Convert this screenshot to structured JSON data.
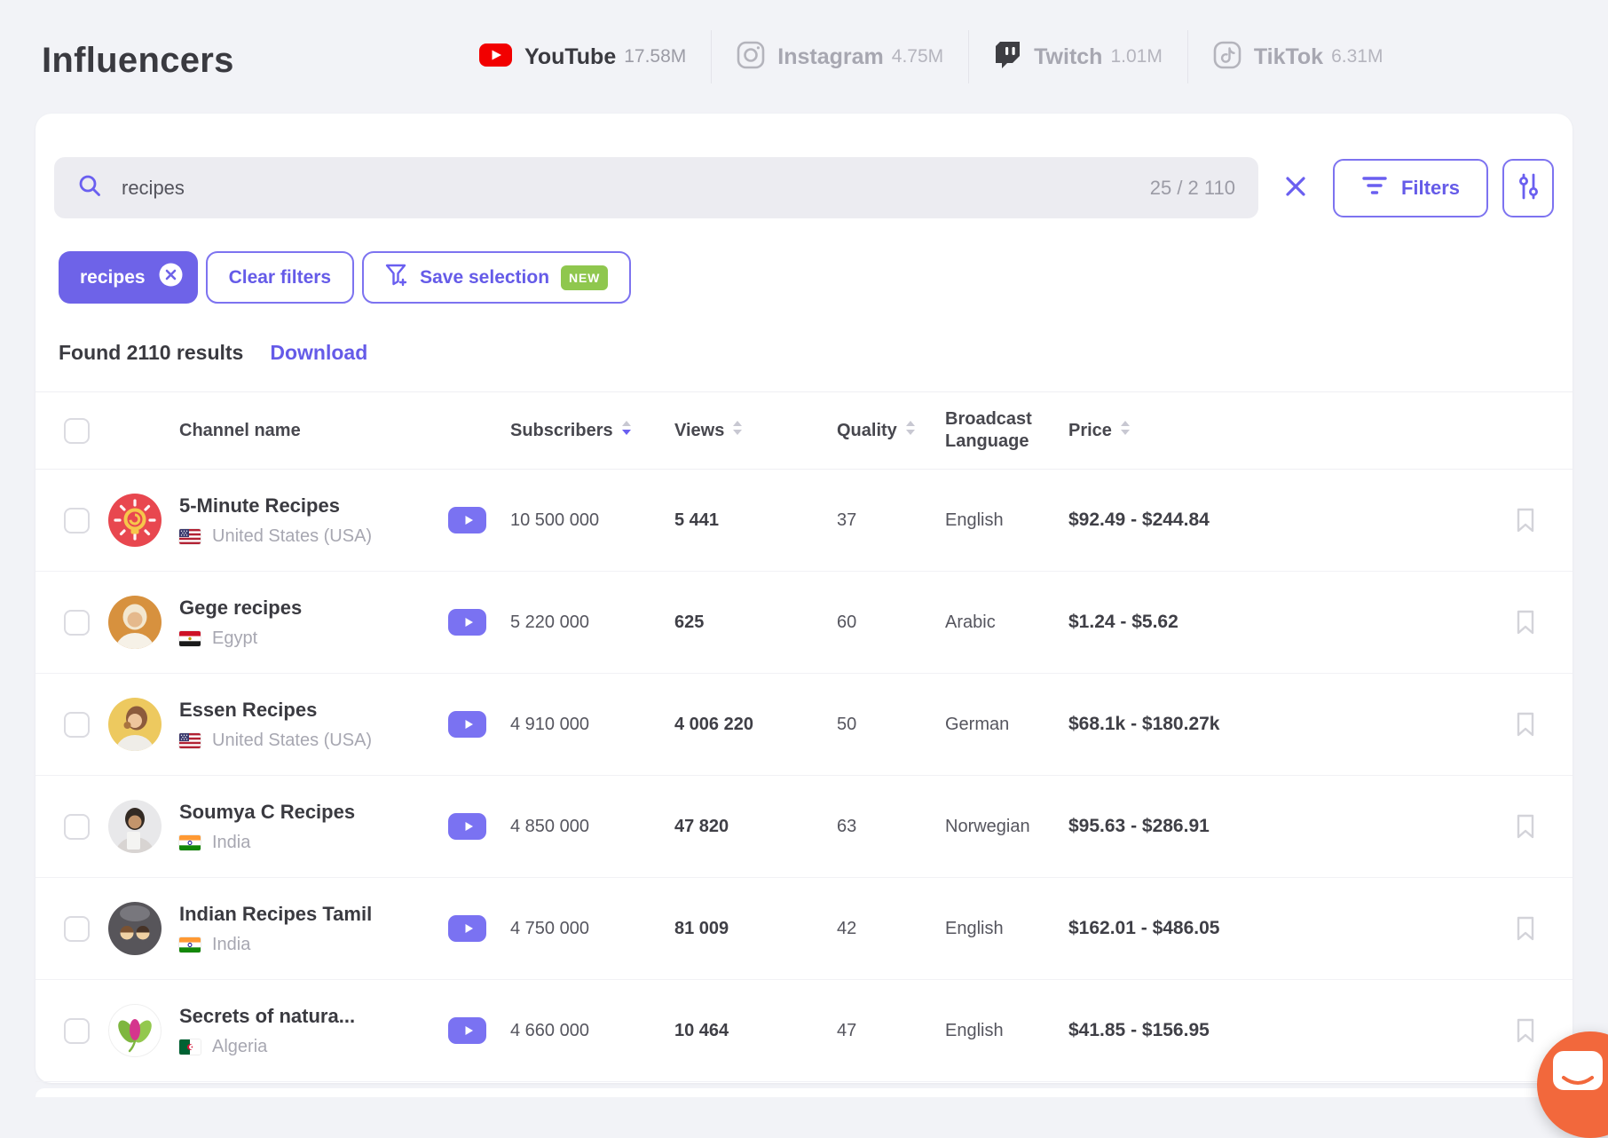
{
  "page": {
    "title": "Influencers"
  },
  "platform_tabs": [
    {
      "label": "YouTube",
      "count": "17.58M",
      "icon": "youtube-icon",
      "active": true
    },
    {
      "label": "Instagram",
      "count": "4.75M",
      "icon": "instagram-icon",
      "active": false
    },
    {
      "label": "Twitch",
      "count": "1.01M",
      "icon": "twitch-icon",
      "active": false
    },
    {
      "label": "TikTok",
      "count": "6.31M",
      "icon": "tiktok-icon",
      "active": false
    }
  ],
  "search": {
    "query": "recipes",
    "counter": "25 / 2 110"
  },
  "toolbar": {
    "filters_label": "Filters",
    "chip_label": "recipes",
    "clear_filters_label": "Clear filters",
    "save_selection_label": "Save selection",
    "new_badge": "NEW"
  },
  "results": {
    "found_text": "Found 2110 results",
    "download_label": "Download"
  },
  "table": {
    "columns": [
      {
        "label": "Channel name",
        "sortable": false
      },
      {
        "label": "Subscribers",
        "sortable": true,
        "sort_active": "desc"
      },
      {
        "label": "Views",
        "sortable": true
      },
      {
        "label": "Quality",
        "sortable": true
      },
      {
        "label": "Broadcast Language",
        "sortable": false
      },
      {
        "label": "Price",
        "sortable": true
      }
    ],
    "rows": [
      {
        "name": "5-Minute Recipes",
        "country": "United States (USA)",
        "flag": "usa-flag",
        "avatar": "red-lightbulb-logo",
        "subscribers": "10 500 000",
        "views": "5 441",
        "quality": "37",
        "language": "English",
        "price": "$92.49 - $244.84"
      },
      {
        "name": "Gege recipes",
        "country": "Egypt",
        "flag": "egypt-flag",
        "avatar": "woman-hijab-portrait",
        "subscribers": "5 220 000",
        "views": "625",
        "quality": "60",
        "language": "Arabic",
        "price": "$1.24 - $5.62"
      },
      {
        "name": "Essen Recipes",
        "country": "United States (USA)",
        "flag": "usa-flag",
        "avatar": "woman-eating-portrait",
        "subscribers": "4 910 000",
        "views": "4 006 220",
        "quality": "50",
        "language": "German",
        "price": "$68.1k - $180.27k"
      },
      {
        "name": "Soumya C Recipes",
        "country": "India",
        "flag": "india-flag",
        "avatar": "woman-portrait",
        "subscribers": "4 850 000",
        "views": "47 820",
        "quality": "63",
        "language": "Norwegian",
        "price": "$95.63 - $286.91"
      },
      {
        "name": "Indian Recipes Tamil",
        "country": "India",
        "flag": "india-flag",
        "avatar": "cartoon-couple-logo",
        "subscribers": "4 750 000",
        "views": "81 009",
        "quality": "42",
        "language": "English",
        "price": "$162.01 - $486.05"
      },
      {
        "name": "Secrets of natura...",
        "country": "Algeria",
        "flag": "algeria-flag",
        "avatar": "pink-green-leaves-logo",
        "subscribers": "4 660 000",
        "views": "10 464",
        "quality": "47",
        "language": "English",
        "price": "$41.85 - $156.95"
      }
    ]
  },
  "colors": {
    "accent_purple": "#655BE8",
    "chip_purple": "#6E63E8",
    "play_button_purple": "#7A72F2",
    "new_badge_green": "#8FC74E",
    "youtube_red": "#F20000",
    "chat_bubble_orange": "#F2683C",
    "page_background": "#F2F3F7"
  }
}
